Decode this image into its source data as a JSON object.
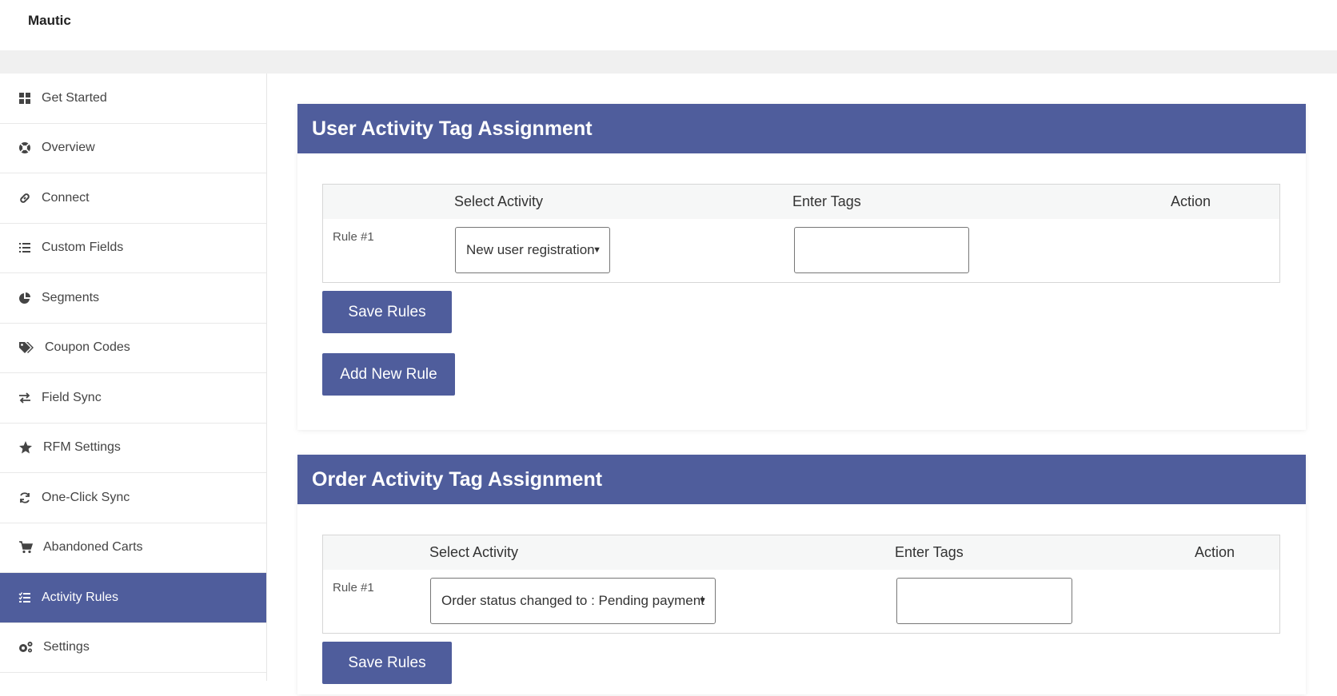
{
  "app": {
    "brand": "Mautic"
  },
  "sidebar": {
    "items": [
      {
        "label": "Get Started",
        "icon": "dashboard-icon"
      },
      {
        "label": "Overview",
        "icon": "lifebuoy-icon"
      },
      {
        "label": "Connect",
        "icon": "link-icon"
      },
      {
        "label": "Custom Fields",
        "icon": "list-icon"
      },
      {
        "label": "Segments",
        "icon": "pie-chart-icon"
      },
      {
        "label": "Coupon Codes",
        "icon": "tags-icon"
      },
      {
        "label": "Field Sync",
        "icon": "exchange-icon"
      },
      {
        "label": "RFM Settings",
        "icon": "star-icon"
      },
      {
        "label": "One-Click Sync",
        "icon": "refresh-icon"
      },
      {
        "label": "Abandoned Carts",
        "icon": "cart-icon"
      },
      {
        "label": "Activity Rules",
        "icon": "tasks-icon",
        "active": true
      },
      {
        "label": "Settings",
        "icon": "gears-icon"
      }
    ]
  },
  "user_section": {
    "title": "User Activity Tag Assignment",
    "col_activity": "Select Activity",
    "col_tags": "Enter Tags",
    "col_action": "Action",
    "rule_label": "Rule #1",
    "selected_activity": "New user registration",
    "tags_value": "",
    "save_label": "Save Rules",
    "add_label": "Add New Rule"
  },
  "order_section": {
    "title": "Order Activity Tag Assignment",
    "col_activity": "Select Activity",
    "col_tags": "Enter Tags",
    "col_action": "Action",
    "rule_label": "Rule #1",
    "selected_activity": "Order status changed to : Pending payment",
    "tags_value": "",
    "save_label": "Save Rules"
  },
  "colors": {
    "accent": "#4f5d9c",
    "header_bg": "#f6f7f7",
    "page_band": "#f0f0f0"
  }
}
